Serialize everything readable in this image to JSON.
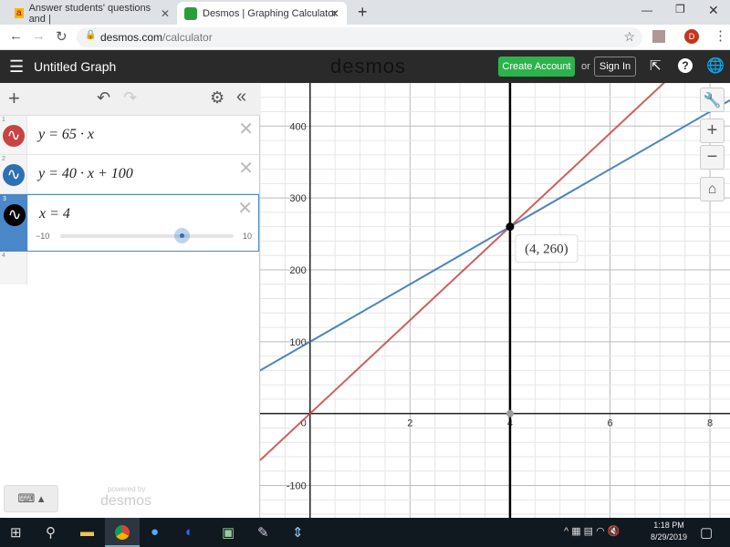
{
  "browser": {
    "tabs": [
      {
        "title": "Answer students' questions and |",
        "active": false
      },
      {
        "title": "Desmos | Graphing Calculator",
        "active": true
      }
    ],
    "url_host": "desmos.com",
    "url_path": "/calculator",
    "profile_initial": "D"
  },
  "header": {
    "title": "Untitled Graph",
    "logo": "desmos",
    "create_account": "Create Account",
    "or": "or",
    "sign_in": "Sign In",
    "accent": "#2cb34c"
  },
  "expressions": [
    {
      "index": "1",
      "latex": "y = 65 · x",
      "color": "#c74440"
    },
    {
      "index": "2",
      "latex": "y = 40 · x + 100",
      "color": "#2d70b3"
    },
    {
      "index": "3",
      "latex": "x = 4",
      "color": "#000000",
      "slider": {
        "min": "−10",
        "max": "10",
        "value": 4
      }
    },
    {
      "index": "4",
      "latex": ""
    }
  ],
  "footer": {
    "powered_by": "powered by",
    "brand": "desmos"
  },
  "chart_data": {
    "type": "line",
    "xlim": [
      -1,
      8.4
    ],
    "ylim": [
      -145,
      460
    ],
    "x_ticks": [
      "2",
      "4",
      "6",
      "8"
    ],
    "y_ticks": [
      "400",
      "300",
      "200",
      "100",
      "-100"
    ],
    "origin_label": "0",
    "grid": true,
    "series": [
      {
        "expr": "y=65x",
        "slope": 65,
        "intercept": 0,
        "color": "#c74440"
      },
      {
        "expr": "y=40x+100",
        "slope": 40,
        "intercept": 100,
        "color": "#2d70b3"
      },
      {
        "expr": "x=4",
        "vertical": 4,
        "color": "#000000"
      }
    ],
    "point": {
      "x": 4,
      "y": 260,
      "label": "(4, 260)"
    }
  },
  "taskbar": {
    "time": "1:18 PM",
    "date": "8/29/2019"
  }
}
